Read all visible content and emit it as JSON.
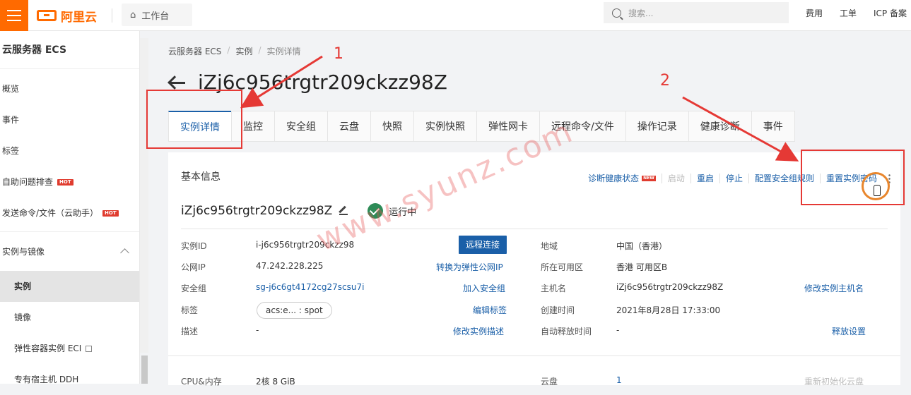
{
  "topbar": {
    "logo_text": "阿里云",
    "workbench_label": "工作台",
    "search_placeholder": "搜索...",
    "links": [
      "费用",
      "工单",
      "ICP 备案"
    ]
  },
  "sidebar": {
    "title": "云服务器 ECS",
    "items": [
      "概览",
      "事件",
      "标签"
    ],
    "hot_items": [
      "自助问题排查",
      "发送命令/文件（云助手）"
    ],
    "hot_badge": "HOT",
    "group": "实例与镜像",
    "sub_items": [
      "实例",
      "镜像",
      "弹性容器实例 ECI",
      "专有宿主机 DDH"
    ],
    "active_sub_item": "实例"
  },
  "breadcrumb": [
    "云服务器 ECS",
    "实例",
    "实例详情"
  ],
  "page_title": "iZj6c956trgtr209ckzz98Z",
  "tabs": [
    "实例详情",
    "监控",
    "安全组",
    "云盘",
    "快照",
    "实例快照",
    "弹性网卡",
    "远程命令/文件",
    "操作记录",
    "健康诊断",
    "事件"
  ],
  "active_tab": "实例详情",
  "panel": {
    "title": "基本信息",
    "actions": {
      "diagnose": "诊断健康状态",
      "new_badge": "NEW",
      "start": "启动",
      "restart": "重启",
      "stop": "停止",
      "config_sg_rules": "配置安全组规则",
      "reset_password": "重置实例密码"
    },
    "instance_name": "iZj6c956trgtr209ckzz98Z",
    "status": "运行中",
    "left_rows": [
      {
        "label": "实例ID",
        "value": "i-j6c956trgtr209ckzz98",
        "action": "远程连接"
      },
      {
        "label": "公网IP",
        "value": "47.242.228.225",
        "action": "转换为弹性公网IP"
      },
      {
        "label": "安全组",
        "value": "sg-j6c6gt4172cg27scsu7i",
        "action": "加入安全组"
      },
      {
        "label": "标签",
        "value": "acs:e... : spot",
        "action": "编辑标签"
      },
      {
        "label": "描述",
        "value": "-",
        "action": "修改实例描述"
      }
    ],
    "right_rows": [
      {
        "label": "地域",
        "value": "中国（香港）",
        "action": ""
      },
      {
        "label": "所在可用区",
        "value": "香港 可用区B",
        "action": ""
      },
      {
        "label": "主机名",
        "value": "iZj6c956trgtr209ckzz98Z",
        "action": "修改实例主机名"
      },
      {
        "label": "创建时间",
        "value": "2021年8月28日 17:33:00",
        "action": ""
      },
      {
        "label": "自动释放时间",
        "value": "-",
        "action": "释放设置"
      }
    ],
    "bottom_row": {
      "left_label": "CPU&内存",
      "left_value": "2核 8 GiB",
      "right_label": "云盘",
      "right_value": "1",
      "right_action": "重新初始化云盘"
    }
  },
  "annotations": {
    "one": "1",
    "two": "2"
  },
  "watermark": "www.syunz.com",
  "colors": {
    "brand": "#ff6a00",
    "link": "#1a5fa8",
    "annotation": "#e53935",
    "running": "#2e8b57"
  }
}
